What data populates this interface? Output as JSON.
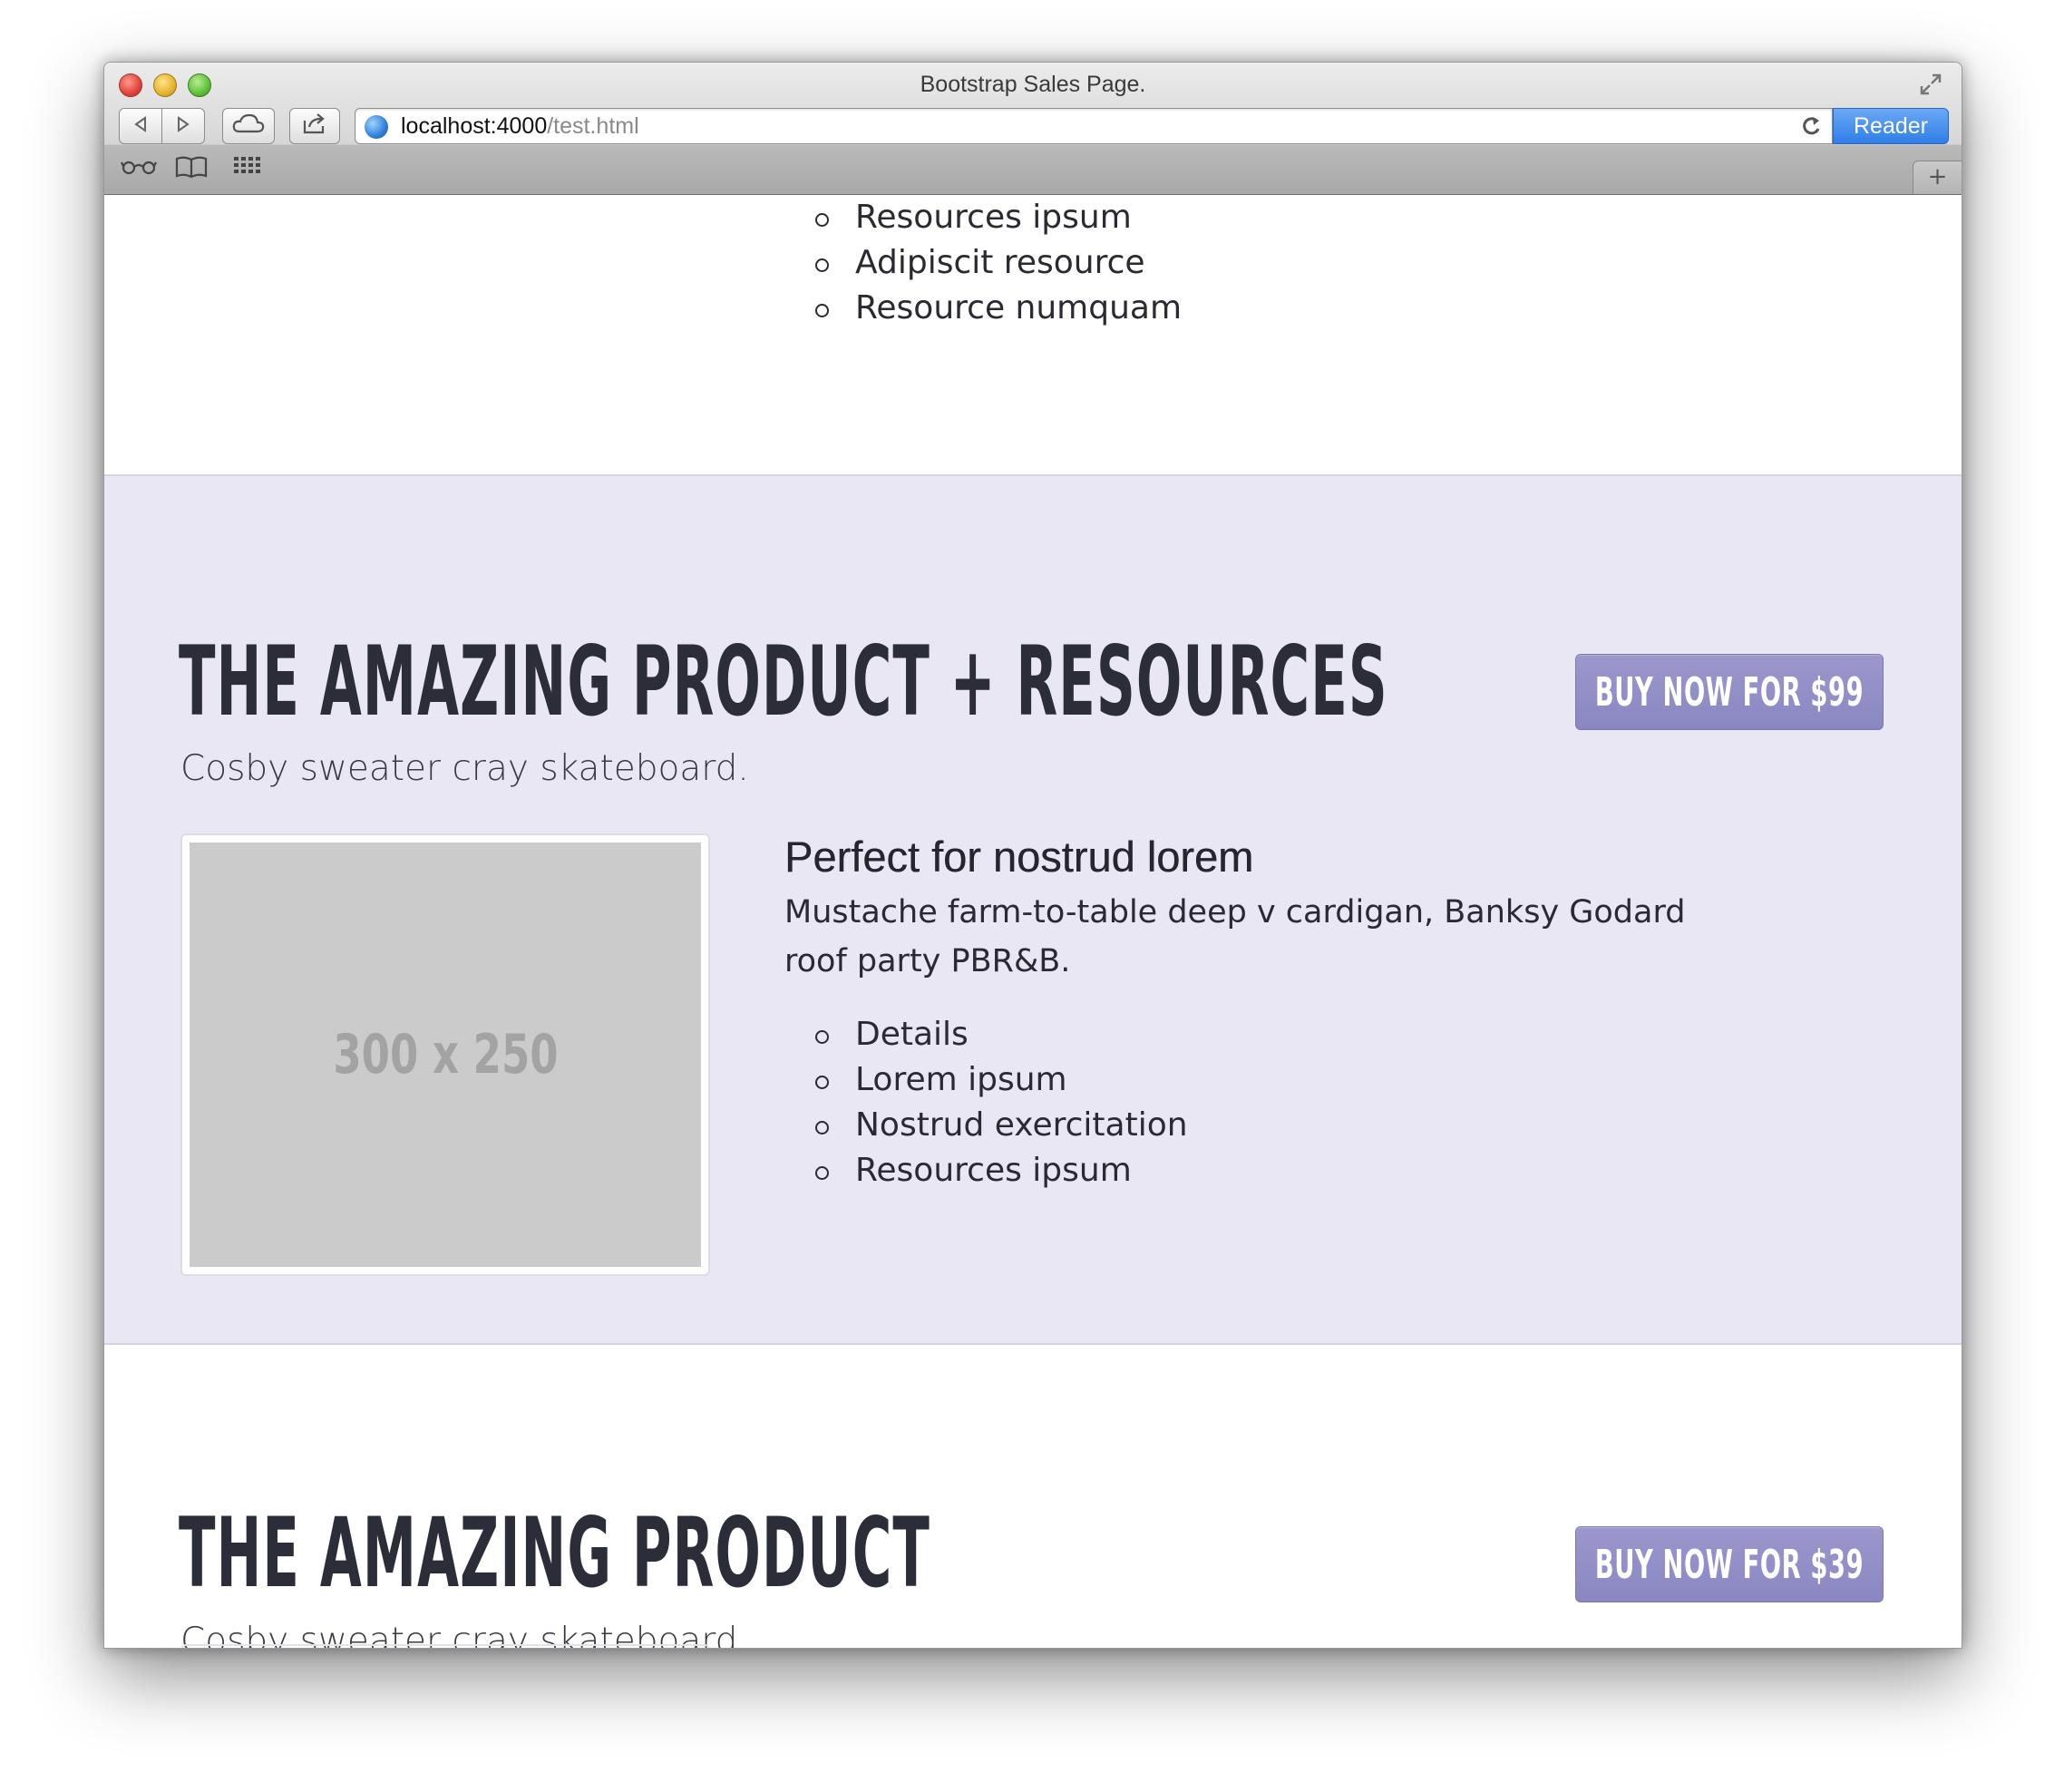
{
  "window": {
    "title": "Bootstrap Sales Page.",
    "url_host": "localhost:4000",
    "url_path": "/test.html",
    "reader_label": "Reader"
  },
  "top_list": [
    "Resources ipsum",
    "Adipiscit resource",
    "Resource numquam"
  ],
  "product_plus": {
    "headline": "THE AMAZING PRODUCT + RESOURCES",
    "button": "BUY NOW FOR $99",
    "tagline": "Cosby sweater cray skateboard.",
    "image_placeholder": "300 x 250",
    "feature_title": "Perfect for nostrud lorem",
    "feature_desc": "Mustache farm-to-table deep v cardigan, Banksy Godard roof party PBR&B.",
    "details": [
      "Details",
      "Lorem ipsum",
      "Nostrud exercitation",
      "Resources ipsum"
    ]
  },
  "product": {
    "headline": "THE AMAZING PRODUCT",
    "button": "BUY NOW FOR $39",
    "tagline": "Cosby sweater cray skateboard."
  },
  "colors": {
    "band_bg": "#e9e7f3",
    "button_bg": "#8f8bc5",
    "headline": "#2b2d38",
    "reader_blue": "#2e7ee8"
  },
  "icons": [
    "close-window-icon",
    "minimize-window-icon",
    "zoom-window-icon",
    "fullscreen-icon",
    "back-arrow-icon",
    "forward-arrow-icon",
    "icloud-tabs-icon",
    "share-icon",
    "globe-icon",
    "reload-icon",
    "reading-list-icon",
    "bookmarks-icon",
    "top-sites-icon",
    "new-tab-icon"
  ]
}
